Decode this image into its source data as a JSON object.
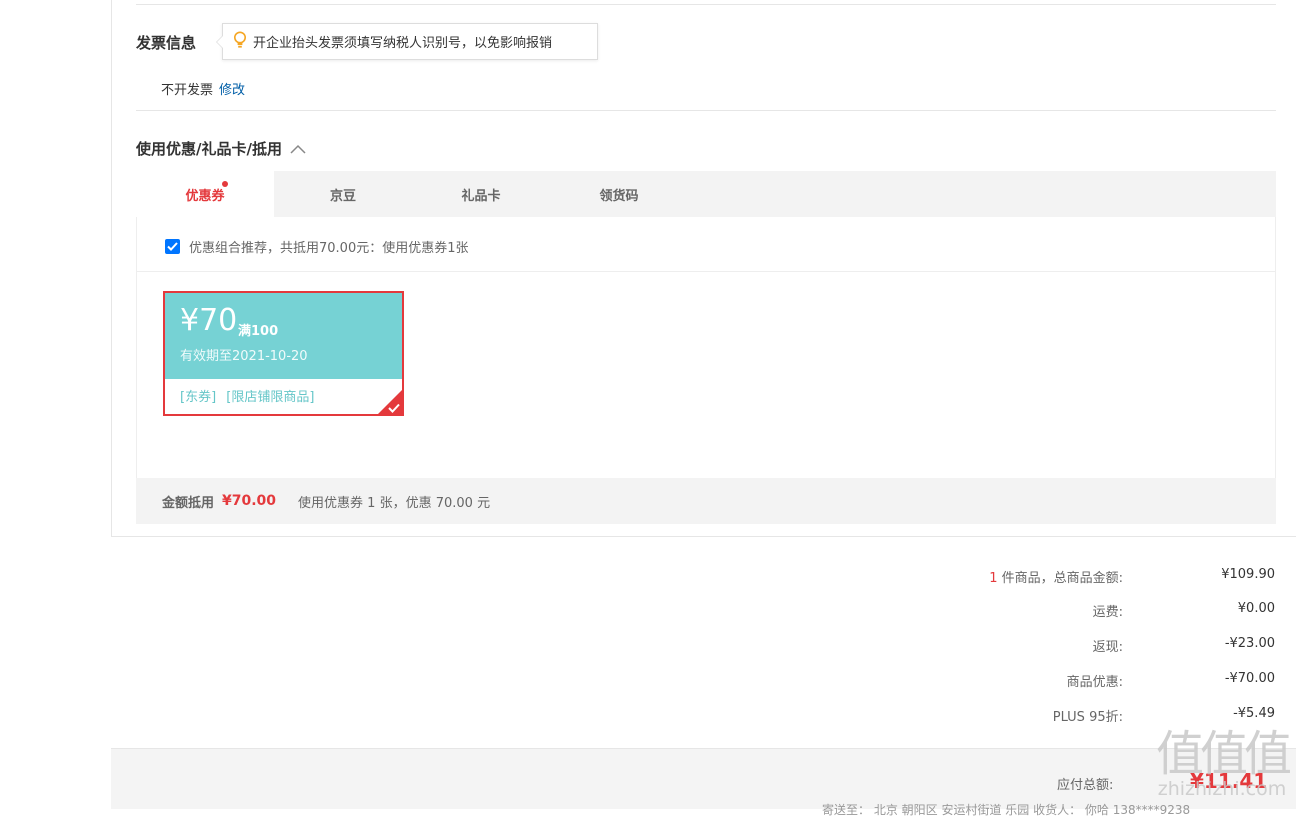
{
  "invoice": {
    "title": "发票信息",
    "tip": "开企业抬头发票须填写纳税人识别号，以免影响报销",
    "status": "不开发票",
    "edit_link": "修改"
  },
  "discount": {
    "title": "使用优惠/礼品卡/抵用",
    "tabs": [
      {
        "label": "优惠券",
        "active": true
      },
      {
        "label": "京豆",
        "active": false
      },
      {
        "label": "礼品卡",
        "active": false
      },
      {
        "label": "领货码",
        "active": false
      }
    ],
    "recommend_text": "优惠组合推荐，共抵用70.00元：使用优惠券1张",
    "recommend_checked": true,
    "coupon": {
      "amount": "¥70",
      "condition": "满100",
      "expiry": "有效期至2021-10-20",
      "tags": [
        "[东券]",
        "[限店铺限商品]"
      ],
      "selected": true,
      "color": "#76d2d4"
    },
    "deduct": {
      "label": "金额抵用",
      "amount": "¥70.00",
      "desc": "使用优惠券 1 张，优惠 70.00 元"
    }
  },
  "summary": {
    "items_count": "1",
    "items_label": " 件商品，总商品金额:",
    "items_total": "¥109.90",
    "rows": [
      {
        "label": "运费:",
        "value": "¥0.00"
      },
      {
        "label": "返现:",
        "value": "-¥23.00"
      },
      {
        "label": "商品优惠:",
        "value": "-¥70.00"
      },
      {
        "label": "PLUS 95折:",
        "value": "-¥5.49"
      }
    ]
  },
  "total": {
    "label": "应付总额:",
    "value": "¥11.41",
    "ship_to": "寄送至：  北京 朝阳区 安运村街道 乐园    收货人：  你哈 138****9238"
  },
  "watermark": {
    "big": "值值值",
    "small": "zhizhizhi.com"
  },
  "colors": {
    "accent_red": "#e4393c",
    "link_blue": "#005ea7",
    "coupon_teal": "#76d2d4"
  }
}
